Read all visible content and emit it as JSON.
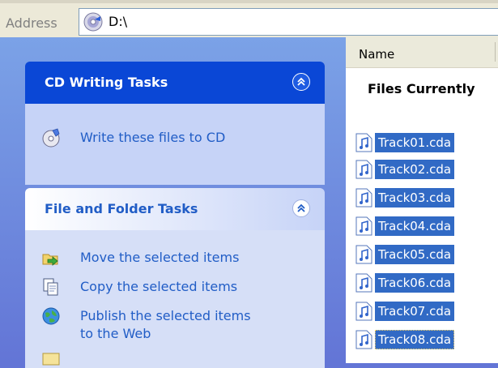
{
  "address_bar": {
    "label": "Address",
    "value": "D:\\"
  },
  "task_pane": {
    "cd_tasks": {
      "title": "CD Writing Tasks",
      "items": [
        {
          "label": "Write these files to CD",
          "icon": "cd-write-icon"
        }
      ]
    },
    "file_folder_tasks": {
      "title": "File and Folder Tasks",
      "items": [
        {
          "label": "Move the selected items",
          "icon": "move-icon"
        },
        {
          "label": "Copy the selected items",
          "icon": "copy-icon"
        },
        {
          "label_line1": "Publish the selected items",
          "label_line2": "to the Web",
          "icon": "publish-web-icon"
        }
      ]
    }
  },
  "file_list": {
    "column_header": "Name",
    "group_label": "Files Currently",
    "files": [
      {
        "name": "Track01.cda"
      },
      {
        "name": "Track02.cda"
      },
      {
        "name": "Track03.cda"
      },
      {
        "name": "Track04.cda"
      },
      {
        "name": "Track05.cda"
      },
      {
        "name": "Track06.cda"
      },
      {
        "name": "Track07.cda"
      },
      {
        "name": "Track08.cda"
      }
    ]
  },
  "colors": {
    "selection": "#316AC5",
    "task_link": "#215DC6",
    "pane_header_dark": "#0A47D6"
  }
}
